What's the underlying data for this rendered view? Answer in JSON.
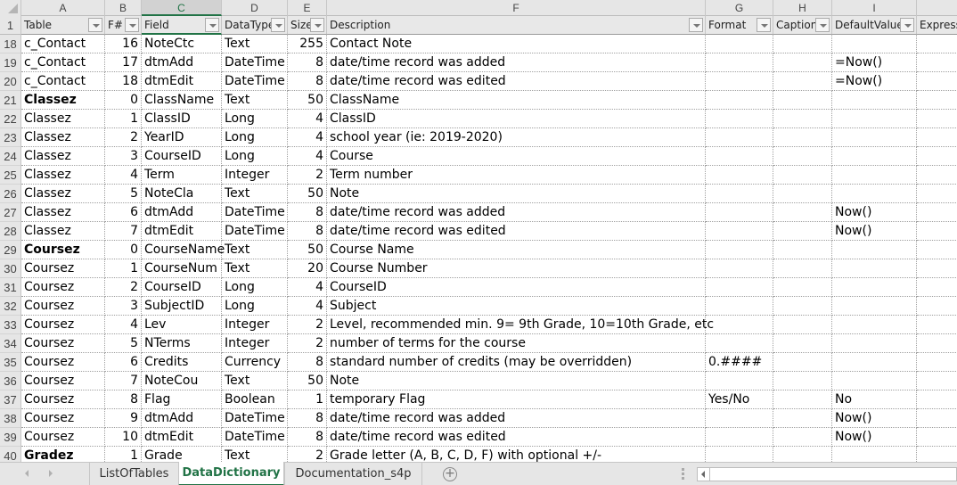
{
  "columns": [
    "A",
    "B",
    "C",
    "D",
    "E",
    "F",
    "G",
    "H",
    "I",
    ""
  ],
  "selected_column": "C",
  "header_row": {
    "row_number": "1",
    "headers": [
      "Table",
      "F#",
      "Field",
      "DataType",
      "Size",
      "Description",
      "Format",
      "Caption",
      "DefaultValue",
      "Express"
    ]
  },
  "rows": [
    {
      "n": "18",
      "table": "c_Contact",
      "fnum": "16",
      "field": "NoteCtc",
      "type": "Text",
      "size": "255",
      "desc": "Contact Note",
      "format": "",
      "caption": "",
      "default": "",
      "bold": false
    },
    {
      "n": "19",
      "table": "c_Contact",
      "fnum": "17",
      "field": "dtmAdd",
      "type": "DateTime",
      "size": "8",
      "desc": "date/time record was added",
      "format": "",
      "caption": "",
      "default": "=Now()",
      "bold": false
    },
    {
      "n": "20",
      "table": "c_Contact",
      "fnum": "18",
      "field": "dtmEdit",
      "type": "DateTime",
      "size": "8",
      "desc": "date/time record was edited",
      "format": "",
      "caption": "",
      "default": "=Now()",
      "bold": false
    },
    {
      "n": "21",
      "table": "Classez",
      "fnum": "0",
      "field": "ClassName",
      "type": "Text",
      "size": "50",
      "desc": "ClassName",
      "format": "",
      "caption": "",
      "default": "",
      "bold": true
    },
    {
      "n": "22",
      "table": "Classez",
      "fnum": "1",
      "field": "ClassID",
      "type": "Long",
      "size": "4",
      "desc": "ClassID",
      "format": "",
      "caption": "",
      "default": "",
      "bold": false
    },
    {
      "n": "23",
      "table": "Classez",
      "fnum": "2",
      "field": "YearID",
      "type": "Long",
      "size": "4",
      "desc": "school year (ie: 2019-2020)",
      "format": "",
      "caption": "",
      "default": "",
      "bold": false
    },
    {
      "n": "24",
      "table": "Classez",
      "fnum": "3",
      "field": "CourseID",
      "type": "Long",
      "size": "4",
      "desc": "Course",
      "format": "",
      "caption": "",
      "default": "",
      "bold": false
    },
    {
      "n": "25",
      "table": "Classez",
      "fnum": "4",
      "field": "Term",
      "type": "Integer",
      "size": "2",
      "desc": "Term number",
      "format": "",
      "caption": "",
      "default": "",
      "bold": false
    },
    {
      "n": "26",
      "table": "Classez",
      "fnum": "5",
      "field": "NoteCla",
      "type": "Text",
      "size": "50",
      "desc": "Note",
      "format": "",
      "caption": "",
      "default": "",
      "bold": false
    },
    {
      "n": "27",
      "table": "Classez",
      "fnum": "6",
      "field": "dtmAdd",
      "type": "DateTime",
      "size": "8",
      "desc": "date/time record was added",
      "format": "",
      "caption": "",
      "default": "Now()",
      "bold": false
    },
    {
      "n": "28",
      "table": "Classez",
      "fnum": "7",
      "field": "dtmEdit",
      "type": "DateTime",
      "size": "8",
      "desc": "date/time record was edited",
      "format": "",
      "caption": "",
      "default": "Now()",
      "bold": false
    },
    {
      "n": "29",
      "table": "Coursez",
      "fnum": "0",
      "field": "CourseName",
      "type": "Text",
      "size": "50",
      "desc": "Course Name",
      "format": "",
      "caption": "",
      "default": "",
      "bold": true
    },
    {
      "n": "30",
      "table": "Coursez",
      "fnum": "1",
      "field": "CourseNum",
      "type": "Text",
      "size": "20",
      "desc": "Course Number",
      "format": "",
      "caption": "",
      "default": "",
      "bold": false
    },
    {
      "n": "31",
      "table": "Coursez",
      "fnum": "2",
      "field": "CourseID",
      "type": "Long",
      "size": "4",
      "desc": "CourseID",
      "format": "",
      "caption": "",
      "default": "",
      "bold": false
    },
    {
      "n": "32",
      "table": "Coursez",
      "fnum": "3",
      "field": "SubjectID",
      "type": "Long",
      "size": "4",
      "desc": "Subject",
      "format": "",
      "caption": "",
      "default": "",
      "bold": false
    },
    {
      "n": "33",
      "table": "Coursez",
      "fnum": "4",
      "field": "Lev",
      "type": "Integer",
      "size": "2",
      "desc": "Level, recommended min. 9= 9th Grade, 10=10th Grade, etc",
      "format": "",
      "caption": "",
      "default": "",
      "bold": false
    },
    {
      "n": "34",
      "table": "Coursez",
      "fnum": "5",
      "field": "NTerms",
      "type": "Integer",
      "size": "2",
      "desc": "number of terms for the course",
      "format": "",
      "caption": "",
      "default": "",
      "bold": false
    },
    {
      "n": "35",
      "table": "Coursez",
      "fnum": "6",
      "field": "Credits",
      "type": "Currency",
      "size": "8",
      "desc": "standard number of credits (may be overridden)",
      "format": "0.####",
      "caption": "",
      "default": "",
      "bold": false
    },
    {
      "n": "36",
      "table": "Coursez",
      "fnum": "7",
      "field": "NoteCou",
      "type": "Text",
      "size": "50",
      "desc": "Note",
      "format": "",
      "caption": "",
      "default": "",
      "bold": false
    },
    {
      "n": "37",
      "table": "Coursez",
      "fnum": "8",
      "field": "Flag",
      "type": "Boolean",
      "size": "1",
      "desc": "temporary Flag",
      "format": "Yes/No",
      "caption": "",
      "default": "No",
      "bold": false
    },
    {
      "n": "38",
      "table": "Coursez",
      "fnum": "9",
      "field": "dtmAdd",
      "type": "DateTime",
      "size": "8",
      "desc": "date/time record was added",
      "format": "",
      "caption": "",
      "default": "Now()",
      "bold": false
    },
    {
      "n": "39",
      "table": "Coursez",
      "fnum": "10",
      "field": "dtmEdit",
      "type": "DateTime",
      "size": "8",
      "desc": "date/time record was edited",
      "format": "",
      "caption": "",
      "default": "Now()",
      "bold": false
    },
    {
      "n": "40",
      "table": "Gradez",
      "fnum": "1",
      "field": "Grade",
      "type": "Text",
      "size": "2",
      "desc": "Grade letter (A, B, C, D, F) with optional +/-",
      "format": "",
      "caption": "",
      "default": "",
      "bold": true
    }
  ],
  "sheet_tabs": [
    {
      "label": "ListOfTables",
      "active": false
    },
    {
      "label": "DataDictionary",
      "active": true
    },
    {
      "label": "Documentation_s4p",
      "active": false
    }
  ],
  "add_sheet_label": "+",
  "colors": {
    "accent": "#217346",
    "header_bg": "#e6e6e6"
  }
}
